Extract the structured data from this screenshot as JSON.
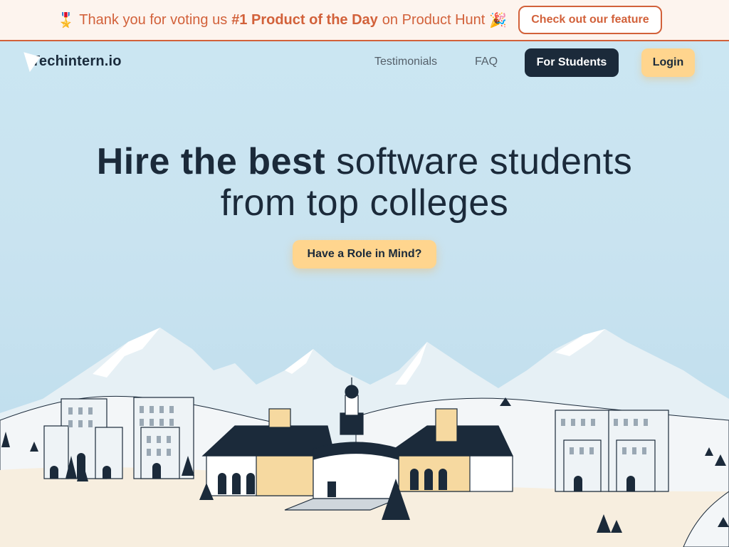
{
  "banner": {
    "emoji_left": "🎖️",
    "text_prefix": "Thank you for voting us",
    "text_bold": "#1 Product of the Day",
    "text_suffix": "on Product Hunt",
    "emoji_right": "🎉",
    "button_label": "Check out our feature"
  },
  "nav": {
    "logo_text": "Techintern.io",
    "links": [
      "Testimonials",
      "FAQ"
    ],
    "students_label": "For Students",
    "login_label": "Login"
  },
  "hero": {
    "title_bold": "Hire the best",
    "title_rest_line1": "software students",
    "title_line2": "from top colleges",
    "cta_label": "Have a Role in Mind?"
  },
  "colors": {
    "accent_orange": "#d2613a",
    "navy": "#1b2a3a",
    "yellow": "#ffd58e",
    "sky": "#cbe6f2"
  }
}
